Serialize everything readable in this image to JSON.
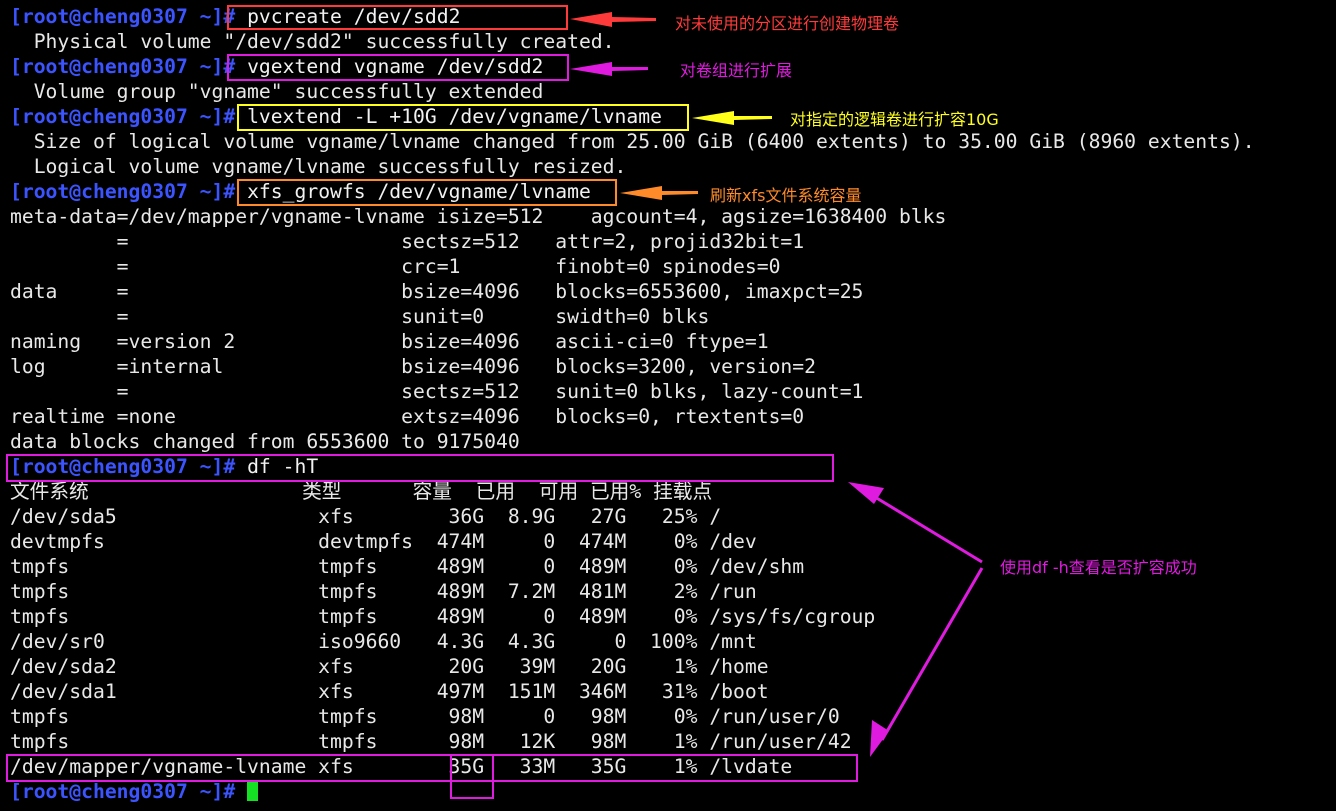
{
  "colors": {
    "background": "#000000",
    "text": "#e8e8e8",
    "prompt": "#3b54ff",
    "cursor": "#16e024",
    "red": "#ff3a3a",
    "magenta": "#e01be0",
    "yellow": "#ffff1a",
    "orange": "#ff8a2a"
  },
  "prompt": "[root@cheng0307 ~]#",
  "lines": [
    {
      "prompt": true,
      "cmd": " pvcreate /dev/sdd2"
    },
    {
      "text": "  Physical volume \"/dev/sdd2\" successfully created."
    },
    {
      "prompt": true,
      "cmd": " vgextend vgname /dev/sdd2"
    },
    {
      "text": "  Volume group \"vgname\" successfully extended"
    },
    {
      "prompt": true,
      "cmd": " lvextend -L +10G /dev/vgname/lvname"
    },
    {
      "text": "  Size of logical volume vgname/lvname changed from 25.00 GiB (6400 extents) to 35.00 GiB (8960 extents)."
    },
    {
      "text": "  Logical volume vgname/lvname successfully resized."
    },
    {
      "prompt": true,
      "cmd": " xfs_growfs /dev/vgname/lvname"
    },
    {
      "text": "meta-data=/dev/mapper/vgname-lvname isize=512    agcount=4, agsize=1638400 blks"
    },
    {
      "text": "         =                       sectsz=512   attr=2, projid32bit=1"
    },
    {
      "text": "         =                       crc=1        finobt=0 spinodes=0"
    },
    {
      "text": "data     =                       bsize=4096   blocks=6553600, imaxpct=25"
    },
    {
      "text": "         =                       sunit=0      swidth=0 blks"
    },
    {
      "text": "naming   =version 2              bsize=4096   ascii-ci=0 ftype=1"
    },
    {
      "text": "log      =internal               bsize=4096   blocks=3200, version=2"
    },
    {
      "text": "         =                       sectsz=512   sunit=0 blks, lazy-count=1"
    },
    {
      "text": "realtime =none                   extsz=4096   blocks=0, rtextents=0"
    },
    {
      "text": "data blocks changed from 6553600 to 9175040"
    },
    {
      "prompt": true,
      "cmd": " df -hT"
    },
    {
      "text": "文件系统                  类型      容量  已用  可用 已用% 挂载点"
    },
    {
      "text": "/dev/sda5                 xfs        36G  8.9G   27G   25% /"
    },
    {
      "text": "devtmpfs                  devtmpfs  474M     0  474M    0% /dev"
    },
    {
      "text": "tmpfs                     tmpfs     489M     0  489M    0% /dev/shm"
    },
    {
      "text": "tmpfs                     tmpfs     489M  7.2M  481M    2% /run"
    },
    {
      "text": "tmpfs                     tmpfs     489M     0  489M    0% /sys/fs/cgroup"
    },
    {
      "text": "/dev/sr0                  iso9660   4.3G  4.3G     0  100% /mnt"
    },
    {
      "text": "/dev/sda2                 xfs        20G   39M   20G    1% /home"
    },
    {
      "text": "/dev/sda1                 xfs       497M  151M  346M   31% /boot"
    },
    {
      "text": "tmpfs                     tmpfs      98M     0   98M    0% /run/user/0"
    },
    {
      "text": "tmpfs                     tmpfs      98M   12K   98M    1% /run/user/42"
    },
    {
      "text": "/dev/mapper/vgname-lvname xfs        35G   33M   35G    1% /lvdate"
    },
    {
      "prompt": true,
      "cmd": " ",
      "cursor": true
    }
  ],
  "annotations": [
    {
      "text": "对未使用的分区进行创建物理卷",
      "color": "red"
    },
    {
      "text": "对卷组进行扩展",
      "color": "magenta"
    },
    {
      "text": "对指定的逻辑卷进行扩容10G",
      "color": "yellow"
    },
    {
      "text": "刷新xfs文件系统容量",
      "color": "orange"
    },
    {
      "text": "使用df -h查看是否扩容成功",
      "color": "magenta"
    }
  ]
}
